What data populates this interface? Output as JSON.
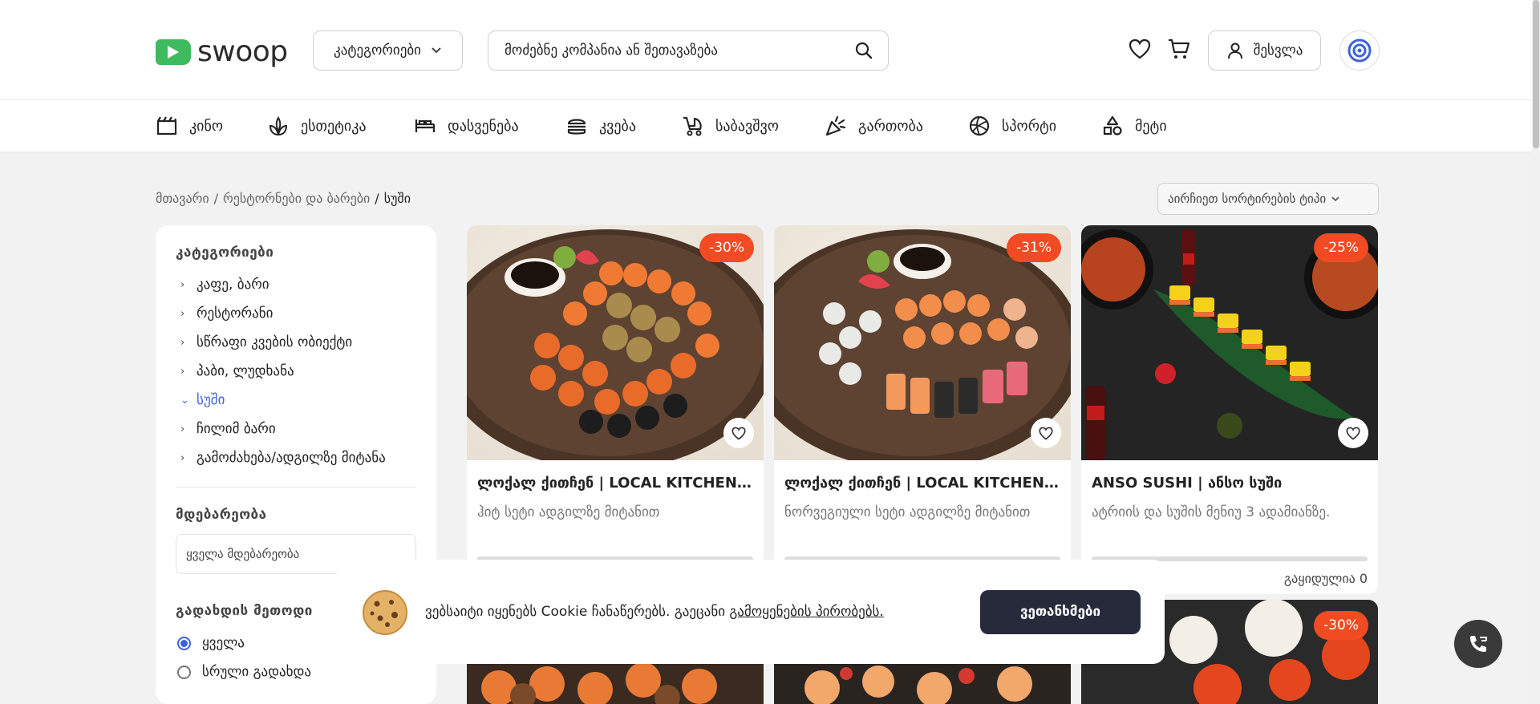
{
  "header": {
    "logo_text": "swoop",
    "categories_label": "კატეგორიები",
    "search_placeholder": "მოძებნე კომპანია ან შეთავაზება",
    "login_label": "შესვლა"
  },
  "nav": [
    {
      "label": "კინო",
      "icon": "cinema-icon"
    },
    {
      "label": "ესთეტიკა",
      "icon": "beauty-icon"
    },
    {
      "label": "დასვენება",
      "icon": "bed-icon"
    },
    {
      "label": "კვება",
      "icon": "burger-icon"
    },
    {
      "label": "საბავშვო",
      "icon": "stroller-icon"
    },
    {
      "label": "გართობა",
      "icon": "party-icon"
    },
    {
      "label": "სპორტი",
      "icon": "ball-icon"
    },
    {
      "label": "მეტი",
      "icon": "shapes-icon"
    }
  ],
  "breadcrumb": {
    "home": "მთავარი",
    "sep1": "/",
    "parent": "რესტორნები და ბარები",
    "sep2": "/",
    "current": "სუში"
  },
  "sort_label": "აირჩიეთ სორტირების ტიპი",
  "sidebar": {
    "categories_title": "კატეგორიები",
    "categories": [
      {
        "label": "კაფე, ბარი",
        "chev": "›"
      },
      {
        "label": "რესტორანი",
        "chev": "›"
      },
      {
        "label": "სწრაფი კვების ობიექტი",
        "chev": "›"
      },
      {
        "label": "პაბი, ლუდხანა",
        "chev": "›"
      },
      {
        "label": "სუში",
        "chev": "⌄"
      },
      {
        "label": "ჩილიმ ბარი",
        "chev": "›"
      },
      {
        "label": "გამოძახება/ადგილზე მიტანა",
        "chev": "›"
      }
    ],
    "location_title": "მდებარეობა",
    "location_placeholder": "ყველა მდებარეობა",
    "payment_title": "გადახდის მეთოდი",
    "payment_options": [
      "ყველა",
      "სრული გადახდა"
    ]
  },
  "cards": [
    {
      "badge": "-30%",
      "title": "ლოქალ ქითჩენ | LOCAL KITCHEN...",
      "desc": "ჰიტ სეტი ადგილზე მიტანით"
    },
    {
      "badge": "-31%",
      "title": "ლოქალ ქითჩენ | LOCAL KITCHEN...",
      "desc": "ნორვეგიული სეტი ადგილზე მიტანით"
    },
    {
      "badge": "-25%",
      "title": "ANSO SUSHI | ანსო სუში",
      "desc": "ატრიის და სუშის მენიუ 3 ადამიანზე.",
      "sold": "გაყიდულია 0"
    }
  ],
  "card_row2_badge": "-30%",
  "cookie": {
    "text": "ვებსაიტი იყენებს Cookie ჩანაწერებს. გაეცანი ",
    "link": "გამოყენების პირობებს.",
    "button": "ვეთანხმები"
  },
  "colors": {
    "accent": "#3d63d9",
    "badge": "#f04b23",
    "brand_green": "#3dbb5e",
    "cookie_button": "#262a3b"
  }
}
